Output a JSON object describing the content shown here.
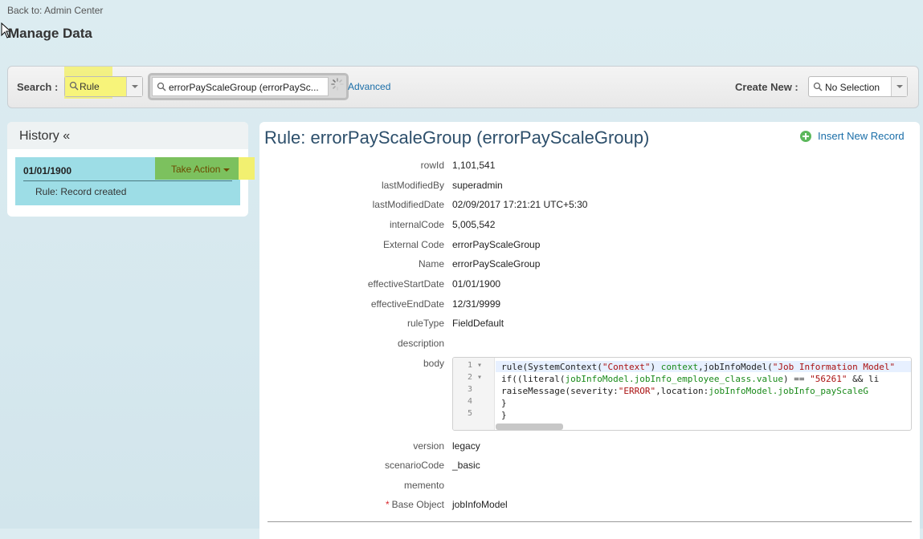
{
  "nav": {
    "back_label": "Back to: Admin Center"
  },
  "page": {
    "title": "Manage Data"
  },
  "search": {
    "label": "Search :",
    "type_value": "Rule",
    "record_value": "errorPayScaleGroup (errorPaySc...",
    "advanced_label": "Advanced",
    "create_new_label": "Create New :",
    "create_new_value": "No Selection"
  },
  "history": {
    "title": "History «",
    "entries": [
      {
        "date": "01/01/1900",
        "action_label": "Take Action",
        "description": "Rule: Record created"
      }
    ]
  },
  "record": {
    "title": "Rule: errorPayScaleGroup (errorPayScaleGroup)",
    "insert_label": "Insert New Record",
    "fields": {
      "rowId": {
        "label": "rowId",
        "value": "1,101,541"
      },
      "lastModifiedBy": {
        "label": "lastModifiedBy",
        "value": "superadmin"
      },
      "lastModifiedDate": {
        "label": "lastModifiedDate",
        "value": "02/09/2017 17:21:21 UTC+5:30"
      },
      "internalCode": {
        "label": "internalCode",
        "value": "5,005,542"
      },
      "externalCode": {
        "label": "External Code",
        "value": "errorPayScaleGroup"
      },
      "name": {
        "label": "Name",
        "value": "errorPayScaleGroup"
      },
      "effectiveStartDate": {
        "label": "effectiveStartDate",
        "value": "01/01/1900"
      },
      "effectiveEndDate": {
        "label": "effectiveEndDate",
        "value": "12/31/9999"
      },
      "ruleType": {
        "label": "ruleType",
        "value": "FieldDefault"
      },
      "description": {
        "label": "description",
        "value": ""
      },
      "body": {
        "label": "body"
      },
      "version": {
        "label": "version",
        "value": "legacy"
      },
      "scenarioCode": {
        "label": "scenarioCode",
        "value": "_basic"
      },
      "memento": {
        "label": "memento",
        "value": ""
      },
      "baseObject": {
        "label": "Base Object",
        "required_mark": "*",
        "value": "jobInfoModel"
      }
    },
    "code": {
      "line_numbers": [
        "1 ▾",
        "2 ▾",
        "3",
        "4",
        "5"
      ],
      "lines": [
        {
          "p1": "rule(SystemContext(",
          "s1": "\"Context\"",
          "p2": ") ",
          "v1": "context",
          "p3": ",jobInfoModel(",
          "s2": "\"Job Information Model\""
        },
        {
          "p1": "  if((literal(",
          "v1": "jobInfoModel.jobInfo_employee_class.value",
          "p2": ") == ",
          "s1": "\"56261\"",
          "p3": " && li"
        },
        {
          "p1": "    raiseMessage(severity:",
          "s1": "\"ERROR\"",
          "p2": ",location:",
          "v1": "jobInfoModel.jobInfo_payScaleG"
        },
        {
          "p1": "    }"
        },
        {
          "p1": "}"
        }
      ]
    }
  },
  "colors": {
    "accent_link": "#1a6ea8",
    "highlight_yellow": "#f2f070",
    "take_action_green": "#7cc15e",
    "history_entry_bg": "#9ddde6",
    "title_blue": "#2d4f6b"
  }
}
